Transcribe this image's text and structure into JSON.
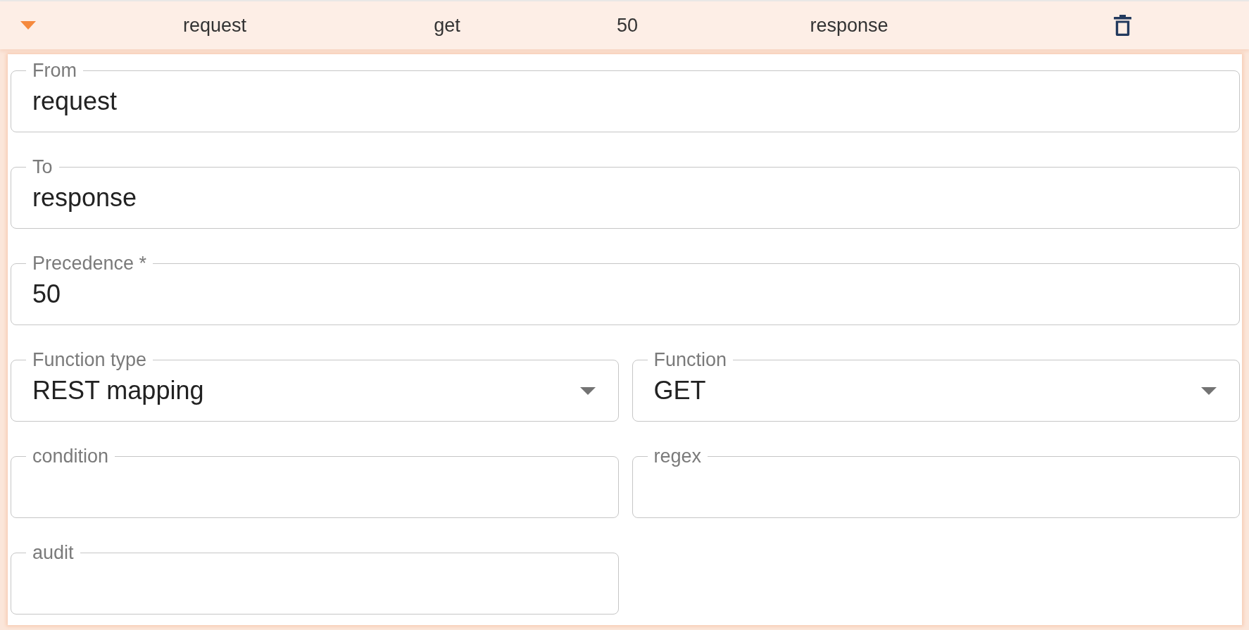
{
  "rule": {
    "expanded": true,
    "summary": [
      "request",
      "get",
      "50",
      "response"
    ]
  },
  "form": {
    "fields": [
      {
        "kind": "text",
        "label": "From",
        "value": "request"
      },
      {
        "kind": "text",
        "label": "To",
        "value": "response"
      },
      {
        "kind": "text",
        "label": "Precedence *",
        "value": "50"
      }
    ],
    "grid_fields": [
      {
        "kind": "select",
        "label": "Function type",
        "value": "REST mapping"
      },
      {
        "kind": "select",
        "label": "Function",
        "value": "GET"
      },
      {
        "kind": "text",
        "label": "condition"
      },
      {
        "kind": "text",
        "label": "regex"
      },
      {
        "kind": "text",
        "label": "audit"
      }
    ]
  }
}
